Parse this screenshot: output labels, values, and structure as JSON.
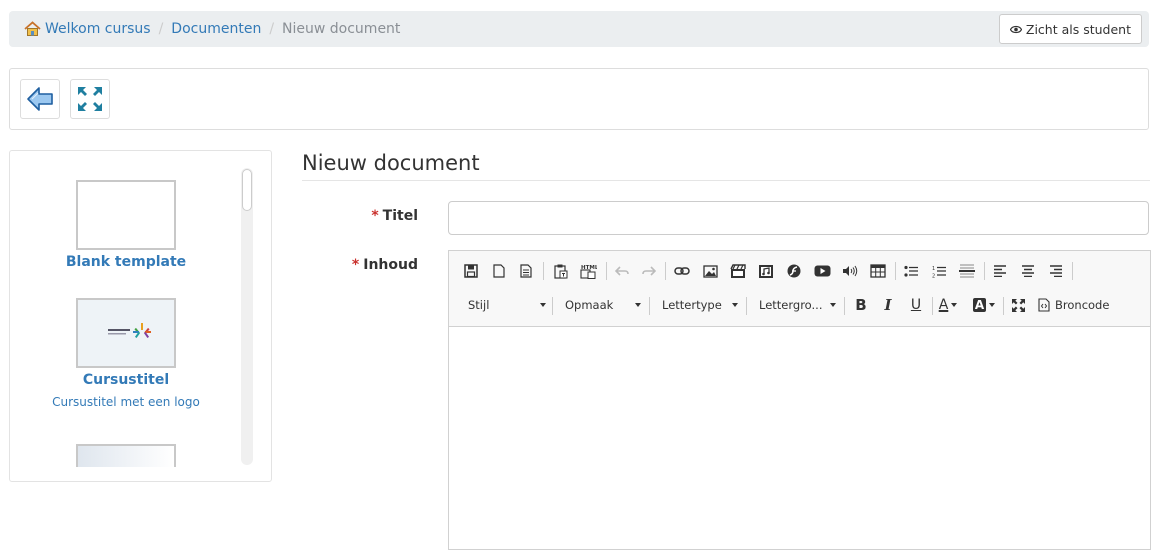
{
  "breadcrumb": {
    "items": [
      {
        "label": "Welkom cursus"
      },
      {
        "label": "Documenten"
      },
      {
        "label": "Nieuw document"
      }
    ],
    "student_view_label": "Zicht als student"
  },
  "actions": {
    "back_icon": "back-arrow-icon",
    "fullscreen_icon": "fullscreen-icon"
  },
  "templates": {
    "items": [
      {
        "title": "Blank template",
        "description": ""
      },
      {
        "title": "Cursustitel",
        "description": "Cursustitel met een logo"
      }
    ]
  },
  "form": {
    "heading": "Nieuw document",
    "title_label": "Titel",
    "content_label": "Inhoud",
    "required_marker": "*",
    "title_value": ""
  },
  "editor": {
    "combos": {
      "style": "Stijl",
      "format": "Opmaak",
      "font": "Lettertype",
      "size": "Lettergro..."
    },
    "source_label": "Broncode",
    "bold_label": "B",
    "italic_label": "I",
    "underline_label": "U",
    "text_color_label": "A",
    "bg_color_label": "A"
  },
  "colors": {
    "link": "#337ab7",
    "required": "#c9302c",
    "breadcrumb_bg": "#ebeef0",
    "icon_teal": "#1f7fa0"
  }
}
